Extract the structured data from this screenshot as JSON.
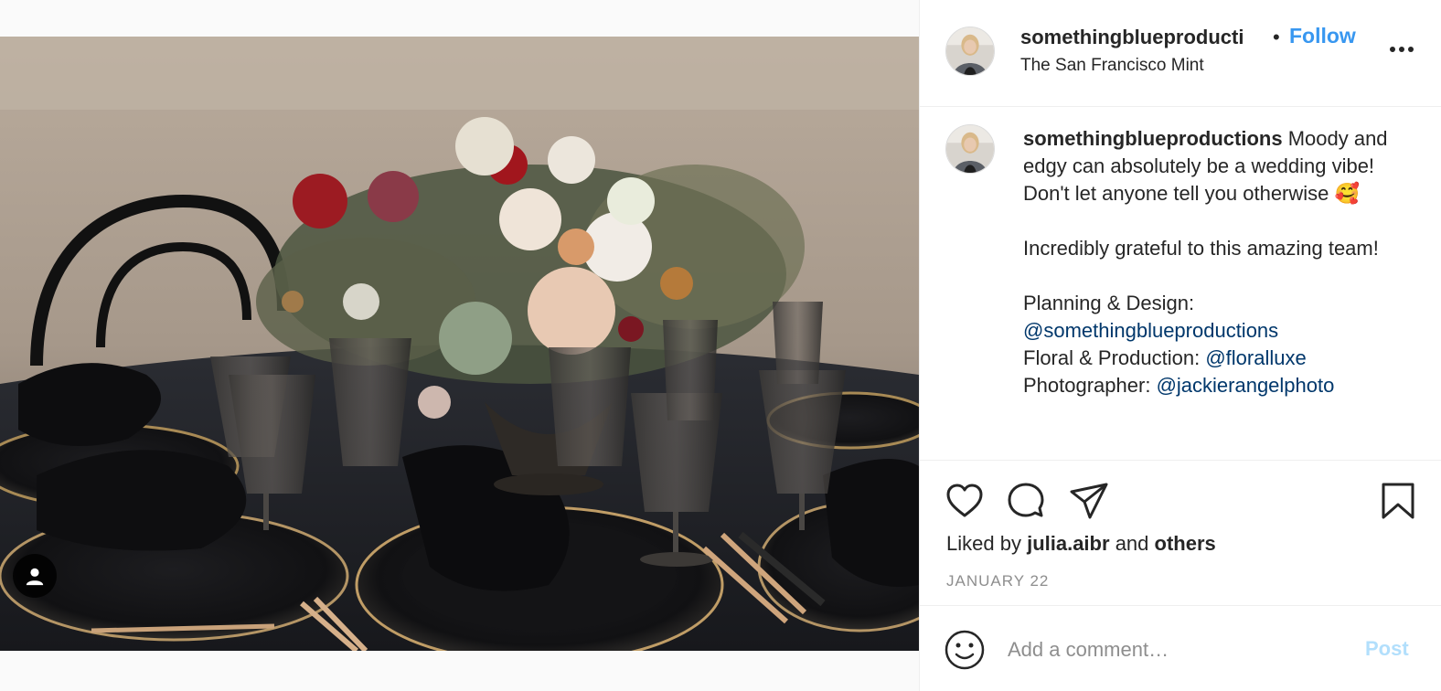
{
  "post": {
    "username": "somethingblueproductions",
    "header_username_display": "somethingblueproducti",
    "separator": "•",
    "follow_label": "Follow",
    "location": "The San Francisco Mint",
    "caption": {
      "line1": "Moody and edgy can absolutely be a wedding vibe! Don't let anyone tell you otherwise 🥰",
      "line2": "Incredibly grateful to this amazing team!",
      "planning_label": "Planning & Design:",
      "planning_mention": "@somethingblueproductions",
      "floral_label": "Floral & Production:",
      "floral_mention": "@floralluxe",
      "photographer_label": "Photographer:",
      "photographer_mention": "@jackierangelphoto"
    },
    "likes": {
      "prefix": "Liked by",
      "user": "julia.aibr",
      "conjunction": "and",
      "others": "others"
    },
    "date": "JANUARY 22"
  },
  "comment_box": {
    "placeholder": "Add a comment…",
    "post_label": "Post"
  },
  "icons": {
    "more": "more-options-icon",
    "like": "heart-icon",
    "comment": "comment-bubble-icon",
    "share": "paper-plane-icon",
    "save": "bookmark-icon",
    "emoji": "smiley-icon",
    "tag": "user-tag-icon"
  },
  "colors": {
    "follow_blue": "#3897f0",
    "mention_blue": "#00376b",
    "post_disabled": "#b2dffc",
    "muted_text": "#8e8e8e",
    "divider": "#efefef"
  }
}
